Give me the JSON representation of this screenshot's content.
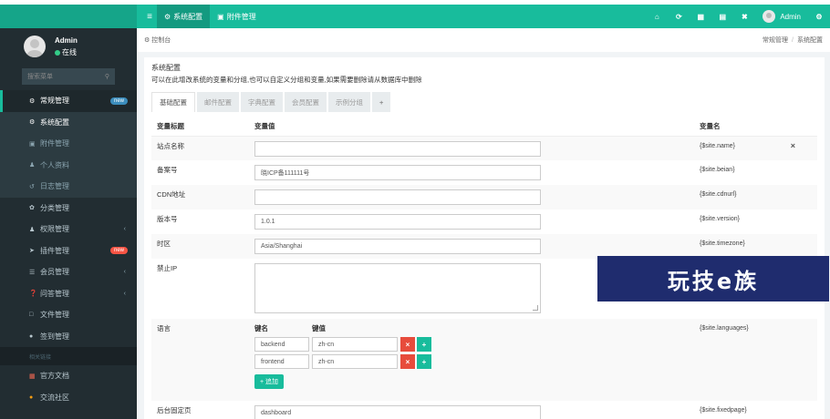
{
  "topbar": {
    "menu_toggle_icon": "bars-icon",
    "tabs": [
      {
        "label": "系统配置",
        "icon": "gear-icon",
        "active": true
      },
      {
        "label": "附件管理",
        "icon": "file-image-icon",
        "active": false
      }
    ],
    "right_icons": [
      "home-icon",
      "refresh-icon",
      "trash-icon",
      "document-icon",
      "expand-icon"
    ],
    "user": "Admin",
    "settings_icon": "gears-icon"
  },
  "sidebar": {
    "user": {
      "name": "Admin",
      "status": "在线"
    },
    "search_placeholder": "搜索菜单",
    "items": [
      {
        "label": "常规管理",
        "icon": "cogs-icon",
        "badge": "new",
        "badge_color": "#3c8dbc",
        "type": "parent-active"
      },
      {
        "label": "系统配置",
        "icon": "gear-icon",
        "type": "sub-current"
      },
      {
        "label": "附件管理",
        "icon": "file-image-icon",
        "type": "sub"
      },
      {
        "label": "个人资料",
        "icon": "user-icon",
        "type": "sub"
      },
      {
        "label": "日志管理",
        "icon": "history-icon",
        "type": "sub"
      },
      {
        "label": "分类管理",
        "icon": "leaf-icon",
        "type": "normal"
      },
      {
        "label": "权限管理",
        "icon": "group-icon",
        "type": "caret"
      },
      {
        "label": "插件管理",
        "icon": "rocket-icon",
        "badge": "new",
        "badge_color": "#f75444",
        "type": "normal"
      },
      {
        "label": "会员管理",
        "icon": "list-icon",
        "type": "caret"
      },
      {
        "label": "问答管理",
        "icon": "question-icon",
        "type": "caret"
      },
      {
        "label": "文件管理",
        "icon": "folder-icon",
        "type": "normal"
      },
      {
        "label": "签到管理",
        "icon": "map-marker-icon",
        "type": "normal"
      }
    ],
    "header": "相关链接",
    "links": [
      {
        "label": "官方文档",
        "icon": "list-alt-icon",
        "color": "#f56954"
      },
      {
        "label": "交流社区",
        "icon": "comment-icon",
        "color": "#f39c12"
      }
    ]
  },
  "breadcrumb": {
    "left": "控制台",
    "right": [
      "常规管理",
      "系统配置"
    ]
  },
  "panel": {
    "title": "系统配置",
    "description": "可以在此增改系统的变量和分组,也可以自定义分组和变量,如果需要删除请从数据库中删除",
    "tabs": [
      "基础配置",
      "邮件配置",
      "字典配置",
      "会员配置",
      "示例分组",
      "+"
    ],
    "active_tab": 0
  },
  "table": {
    "headers": {
      "title": "变量标题",
      "value": "变量值",
      "name": "变量名"
    },
    "rows": [
      {
        "title": "站点名称",
        "value": "",
        "name": "{$site.name}"
      },
      {
        "title": "备案号",
        "value": "晓ICP备111111号",
        "name": "{$site.beian}"
      },
      {
        "title": "CDN地址",
        "value": "",
        "name": "{$site.cdnurl}"
      },
      {
        "title": "版本号",
        "value": "1.0.1",
        "name": "{$site.version}"
      },
      {
        "title": "时区",
        "value": "Asia/Shanghai",
        "name": "{$site.timezone}"
      },
      {
        "title": "禁止IP",
        "value": "",
        "name": ""
      },
      {
        "title": "语言",
        "name": "{$site.languages}"
      },
      {
        "title": "后台固定页",
        "value": "dashboard",
        "name": "{$site.fixedpage}"
      }
    ],
    "languages": {
      "key_header": "键名",
      "value_header": "键值",
      "pairs": [
        {
          "key": "backend",
          "value": "zh-cn"
        },
        {
          "key": "frontend",
          "value": "zh-cn"
        }
      ],
      "add_label": "+ 追加"
    }
  },
  "watermark": "玩技e族"
}
